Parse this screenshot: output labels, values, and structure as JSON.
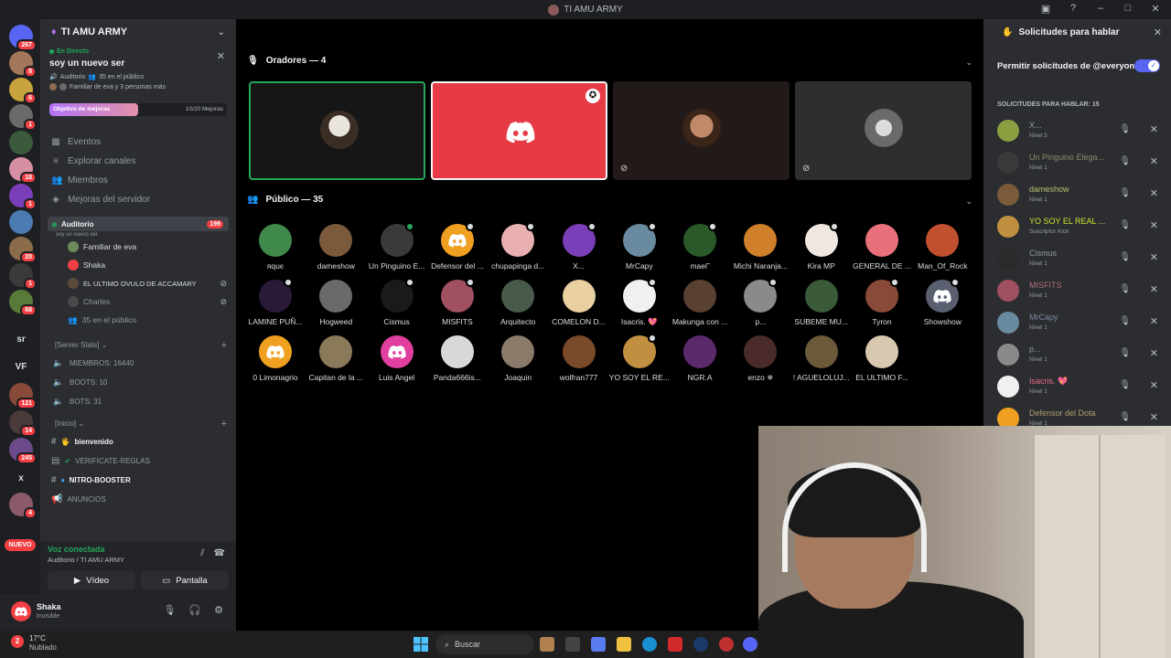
{
  "window": {
    "title": "TI AMU ARMY"
  },
  "rail": {
    "badges": [
      "267",
      "8",
      "6",
      "1",
      "18",
      "1",
      "20",
      "1",
      "68",
      "121",
      "14",
      "245",
      "4"
    ],
    "sr_label": "sr",
    "vf_label": "VF",
    "x_label": "x",
    "nuevo_label": "NUEVO"
  },
  "server": {
    "name": "TI AMU ARMY",
    "live": {
      "tag": "En Directo",
      "title": "soy un nuevo ser",
      "channel": "Auditorio",
      "audience": "35 en el público",
      "speakers": "Familiar de eva y 3 personas más"
    },
    "boost": {
      "label": "Objetivo de mejoras",
      "progress": "10/20 Mejoras",
      "fraction": 0.5
    },
    "nav": [
      "Eventos",
      "Explorar canales",
      "Miembros",
      "Mejoras del servidor"
    ],
    "voice_channel": {
      "name": "Auditorio",
      "count": "199",
      "subtitle": "soy un nuevo ser"
    },
    "voice_users": [
      "Familiar de eva",
      "Shaka",
      "EL ULTIMO OVULO DE ACCAMARY",
      "Charles"
    ],
    "audience_count": "35 en el público",
    "category_stats": "[Server Stats]",
    "stats": [
      "MIEMBROS: 16440",
      "BOOTS: 10",
      "BOTS: 31"
    ],
    "category_inicio": "[Inicio]",
    "text_channels": [
      "bienvenido",
      "VERIFICATE-REGLAS",
      "NITRO-BOOSTER",
      "ANUNCIOS"
    ]
  },
  "voice_panel": {
    "status": "Voz conectada",
    "channel": "Auditorio / TI AMU ARMY",
    "video_label": "Vídeo",
    "screen_label": "Pantalla"
  },
  "user": {
    "name": "Shaka",
    "status": "Invisible"
  },
  "stage": {
    "speakers_header": "Oradores — 4",
    "audience_header": "Público — 35",
    "audience": [
      "яquє",
      "dameshow",
      "Un Pinguino E...",
      "Defensor del ...",
      "chupapinga d...",
      "X...",
      "MrCapy",
      "mael˜",
      "Michi Naranja...",
      "Kira MP",
      "GENERAL DE ...",
      "Man_Of_Rock",
      "LAMINE PUÑ...",
      "Hogweed",
      "Cismus",
      "MISFITS",
      "Arquitecto",
      "COMELON D...",
      "Isacris. 💖",
      "Makunga con ...",
      "p...",
      "SUBEME MU...",
      "Tyron",
      "Showshow",
      "0 Limonagrio",
      "Capitan de la ...",
      "Luis Angel",
      "Panda666is...",
      "Joaquin",
      "wolfran777",
      "YO SOY EL RE...",
      "NGR.A",
      "enzo ✵",
      "! AGUELOLUJ...",
      "EL ULTIMO F..."
    ]
  },
  "requests": {
    "title": "Solicitudes para hablar",
    "permission": "Permitir solicitudes de @everyone",
    "subtitle": "SOLICITUDES PARA HABLAR: 15",
    "items": [
      {
        "name": "X...",
        "level": "Nivel 5"
      },
      {
        "name": "Un Pinguino Elega...",
        "level": "Nivel 1"
      },
      {
        "name": "dameshow",
        "level": "Nivel 1"
      },
      {
        "name": "YO SOY EL REAL ...",
        "level": "Suscriptor Kick"
      },
      {
        "name": "Cismus",
        "level": "Nivel 1"
      },
      {
        "name": "MISFITS",
        "level": "Nivel 1"
      },
      {
        "name": "MrCapy",
        "level": "Nivel 1"
      },
      {
        "name": "p...",
        "level": "Nivel 1"
      },
      {
        "name": "Isacris. 💖",
        "level": "Nivel 1"
      },
      {
        "name": "Defensor del Dota",
        "level": "Nivel 1"
      }
    ]
  },
  "taskbar": {
    "weather_temp": "17°C",
    "weather_desc": "Nublado",
    "weather_badge": "2",
    "search_label": "Buscar"
  },
  "colors": {
    "accent": "#5865f2",
    "live": "#23a55a",
    "danger": "#f23f43",
    "discord_red_tile": "#e63b45"
  }
}
